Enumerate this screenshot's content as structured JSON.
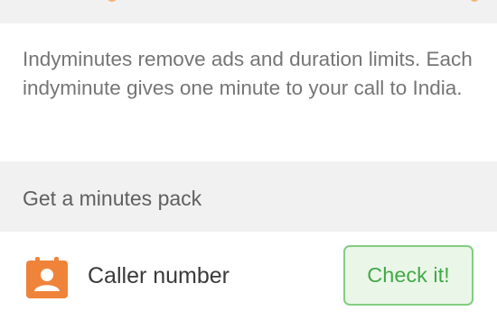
{
  "info": {
    "text": "Indyminutes remove ads and duration limits. Each indyminute gives one minute to your call to India."
  },
  "minutes_pack": {
    "title": "Get a minutes pack"
  },
  "caller_row": {
    "icon": "contact-card-icon",
    "label": "Caller number",
    "button_label": "Check it!"
  },
  "colors": {
    "icon_orange": "#f0833a",
    "button_green": "#44a947",
    "button_border": "#84cc80",
    "button_bg": "#eaf7e8"
  }
}
